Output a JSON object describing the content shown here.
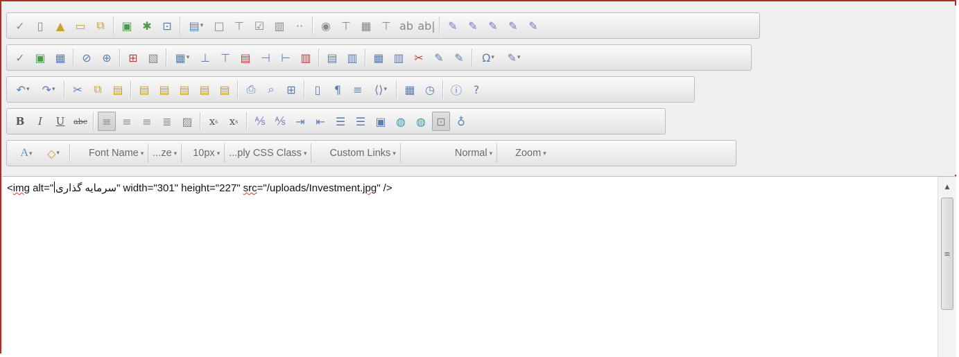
{
  "toolbar": {
    "row5": {
      "forecolor_label": "A",
      "font_name": "Font Name",
      "font_size": "...ze",
      "size_px": "10px",
      "css_class": "...ply CSS Class",
      "custom_links": "Custom Links",
      "paragraph": "Normal",
      "zoom": "Zoom"
    },
    "row4": {
      "bold": "B",
      "italic": "I",
      "underline": "U",
      "strike": "abc",
      "superscript": "x",
      "subscript": "x"
    }
  },
  "editor": {
    "code_prefix": "<",
    "tag": "img",
    "alt_attr": " alt=\"",
    "alt_value": "سرمایه گذاری",
    "rest1": "\" width=\"301\" height=\"227\" ",
    "src_attr": "src",
    "src_value": "=\"/uploads/Investment.",
    "ext": "jpg",
    "close": "\" />"
  },
  "colors": {
    "frame_border": "#b22a2a",
    "toolbar_bg": "#efefef"
  }
}
